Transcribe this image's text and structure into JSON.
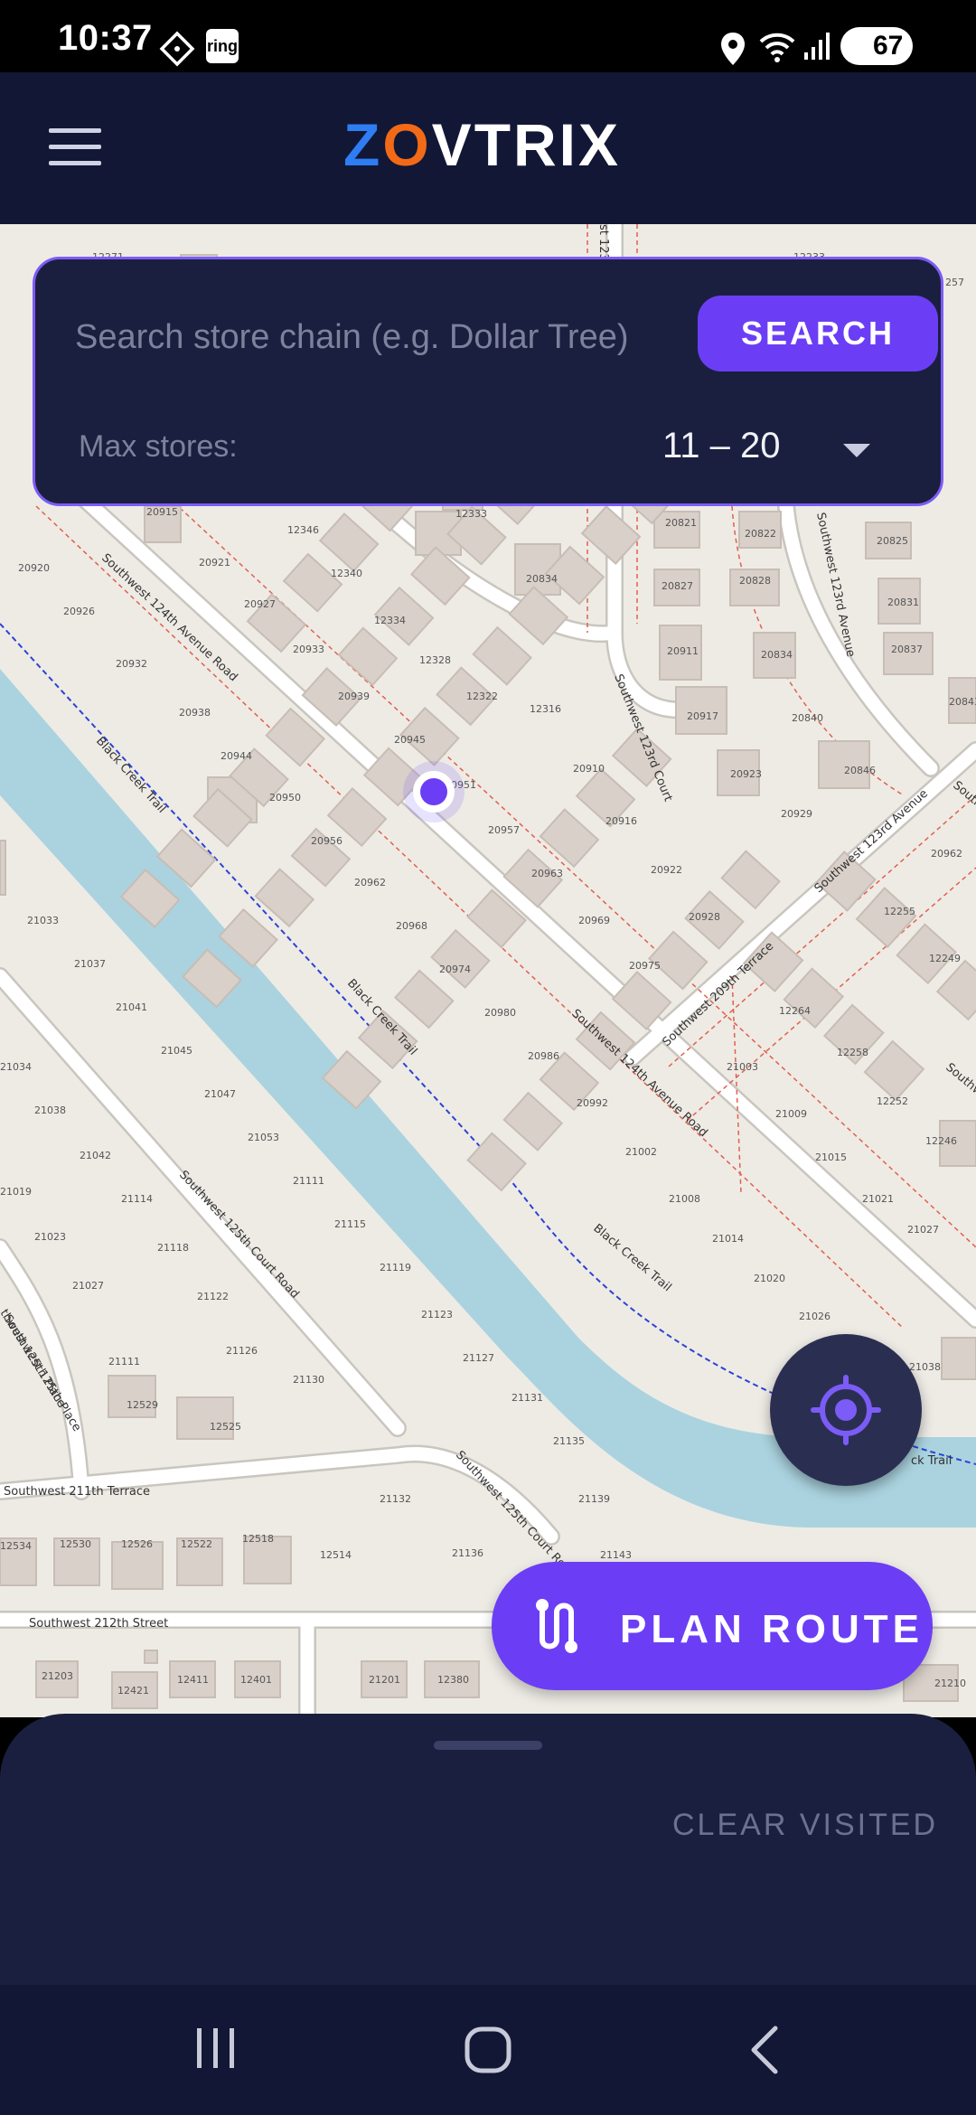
{
  "status_bar": {
    "time": "10:37",
    "app_icon_label": "ring",
    "battery_level": "67",
    "icons": [
      "notification-diamond-icon",
      "ring-app-icon",
      "location-icon",
      "wifi-icon",
      "signal-icon",
      "battery-icon"
    ]
  },
  "app_bar": {
    "logo_text": {
      "z": "Z",
      "o": "O",
      "rest": "VTRIX"
    },
    "menu_icon": "hamburger-menu-icon"
  },
  "search": {
    "placeholder": "Search store chain (e.g. Dollar Tree)",
    "value": "",
    "button_label": "SEARCH",
    "max_stores_label": "Max stores:",
    "max_stores_value": "11 – 20"
  },
  "map": {
    "street_labels": [
      "Southwest 124th Avenue Road",
      "Black Creek Trail",
      "Southwest 123rd Court",
      "Southwest 123rd Avenue",
      "Southwest 209th Terrace",
      "Southwest 125th Court Road",
      "Southwest 125th Place",
      "Southwest 211th Terrace",
      "Southwest 212th Street",
      "Southwest 124th Avenue Road",
      "Black Creek Trail",
      "Southwest 125th Court Road",
      "Black Creek Trail",
      "Southwest 123rd Avenue",
      "Southw",
      "Southw",
      "st 123",
      "thwest 125th Place",
      "ck Trail"
    ],
    "house_numbers": [
      "12333",
      "20834",
      "20821",
      "20822",
      "20825",
      "20827",
      "20828",
      "20831",
      "20915",
      "20921",
      "12346",
      "12340",
      "20920",
      "20926",
      "20927",
      "12334",
      "20933",
      "12328",
      "20932",
      "20938",
      "20939",
      "12322",
      "12316",
      "20911",
      "20834",
      "20837",
      "20917",
      "20840",
      "20843",
      "20944",
      "20945",
      "20950",
      "20951",
      "20910",
      "20916",
      "20923",
      "20846",
      "20929",
      "20956",
      "20957",
      "20962",
      "20963",
      "20922",
      "20928",
      "20969",
      "20968",
      "20975",
      "20974",
      "20980",
      "20986",
      "20992",
      "21002",
      "21008",
      "21014",
      "21020",
      "21026",
      "12264",
      "12258",
      "12252",
      "12246",
      "12255",
      "12249",
      "20962",
      "21003",
      "21009",
      "21015",
      "21021",
      "21027",
      "21033",
      "21037",
      "21041",
      "21045",
      "21047",
      "21053",
      "21111",
      "21115",
      "21119",
      "21123",
      "21127",
      "21131",
      "21135",
      "21139",
      "21143",
      "21038",
      "21042",
      "21114",
      "21118",
      "21122",
      "21126",
      "21130",
      "21023",
      "21027",
      "21111",
      "12529",
      "12525",
      "21132",
      "21136",
      "12534",
      "12530",
      "12526",
      "12522",
      "12518",
      "12514",
      "21203",
      "12421",
      "12411",
      "12401",
      "21201",
      "12380",
      "21210",
      "21038",
      "21034",
      "21019",
      "12271",
      "12233",
      "257"
    ]
  },
  "fab": {
    "locate_icon": "crosshair-locate-icon"
  },
  "plan_route": {
    "label": "PLAN ROUTE",
    "icon": "route-icon"
  },
  "sheet": {
    "clear_visited_label": "CLEAR VISITED"
  },
  "nav_bar": {
    "icons": [
      "recent-apps-icon",
      "home-icon",
      "back-icon"
    ]
  },
  "colors": {
    "accent": "#6b3ef5",
    "appbar": "#121735",
    "card": "#1b1f3f",
    "map_bg": "#eeebe5",
    "water": "#aad3df",
    "building": "#d9d0c9"
  }
}
